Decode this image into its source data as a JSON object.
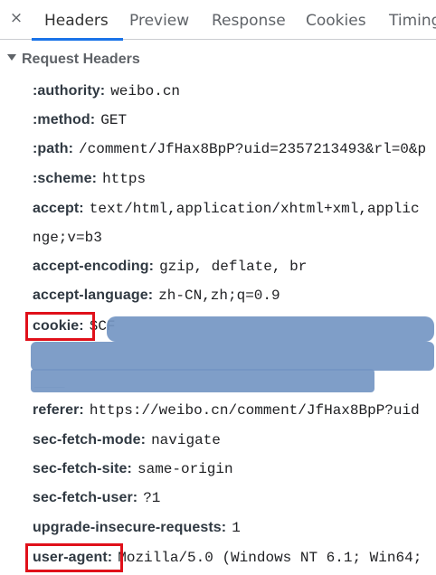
{
  "tabs": {
    "close": "×",
    "items": [
      "Headers",
      "Preview",
      "Response",
      "Cookies",
      "Timing"
    ],
    "active": "Headers"
  },
  "section": {
    "title": "Request Headers"
  },
  "headers": [
    {
      "name": ":authority:",
      "value": "weibo.cn"
    },
    {
      "name": ":method:",
      "value": "GET"
    },
    {
      "name": ":path:",
      "value": "/comment/JfHax8BpP?uid=2357213493&rl=0&p"
    },
    {
      "name": ":scheme:",
      "value": "https"
    },
    {
      "name": "accept:",
      "value": "text/html,application/xhtml+xml,applic",
      "continuation": "nge;v=b3"
    },
    {
      "name": "accept-encoding:",
      "value": "gzip, deflate, br"
    },
    {
      "name": "accept-language:",
      "value": "zh-CN,zh;q=0.9"
    },
    {
      "name": "cookie:",
      "value": "SCF"
    },
    {
      "name": "referer:",
      "value": "https://weibo.cn/comment/JfHax8BpP?uid"
    },
    {
      "name": "sec-fetch-mode:",
      "value": "navigate"
    },
    {
      "name": "sec-fetch-site:",
      "value": "same-origin"
    },
    {
      "name": "sec-fetch-user:",
      "value": "?1"
    },
    {
      "name": "upgrade-insecure-requests:",
      "value": "1"
    },
    {
      "name": "user-agent:",
      "value": "Mozilla/5.0 (Windows NT 6.1; Win64;"
    }
  ],
  "colors": {
    "highlight": "#e0101a",
    "redaction": "#7496c3",
    "tab_active_underline": "#1a73e8"
  }
}
